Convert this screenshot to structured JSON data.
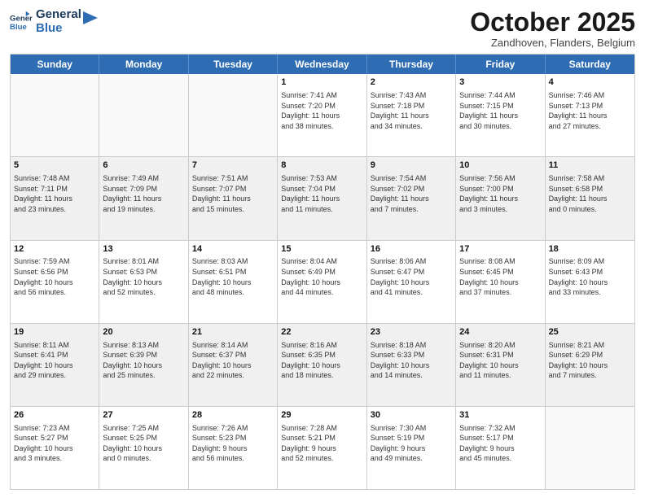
{
  "header": {
    "logo_line1": "General",
    "logo_line2": "Blue",
    "month": "October 2025",
    "location": "Zandhoven, Flanders, Belgium"
  },
  "days": [
    "Sunday",
    "Monday",
    "Tuesday",
    "Wednesday",
    "Thursday",
    "Friday",
    "Saturday"
  ],
  "rows": [
    [
      {
        "day": "",
        "info": ""
      },
      {
        "day": "",
        "info": ""
      },
      {
        "day": "",
        "info": ""
      },
      {
        "day": "1",
        "info": "Sunrise: 7:41 AM\nSunset: 7:20 PM\nDaylight: 11 hours\nand 38 minutes."
      },
      {
        "day": "2",
        "info": "Sunrise: 7:43 AM\nSunset: 7:18 PM\nDaylight: 11 hours\nand 34 minutes."
      },
      {
        "day": "3",
        "info": "Sunrise: 7:44 AM\nSunset: 7:15 PM\nDaylight: 11 hours\nand 30 minutes."
      },
      {
        "day": "4",
        "info": "Sunrise: 7:46 AM\nSunset: 7:13 PM\nDaylight: 11 hours\nand 27 minutes."
      }
    ],
    [
      {
        "day": "5",
        "info": "Sunrise: 7:48 AM\nSunset: 7:11 PM\nDaylight: 11 hours\nand 23 minutes."
      },
      {
        "day": "6",
        "info": "Sunrise: 7:49 AM\nSunset: 7:09 PM\nDaylight: 11 hours\nand 19 minutes."
      },
      {
        "day": "7",
        "info": "Sunrise: 7:51 AM\nSunset: 7:07 PM\nDaylight: 11 hours\nand 15 minutes."
      },
      {
        "day": "8",
        "info": "Sunrise: 7:53 AM\nSunset: 7:04 PM\nDaylight: 11 hours\nand 11 minutes."
      },
      {
        "day": "9",
        "info": "Sunrise: 7:54 AM\nSunset: 7:02 PM\nDaylight: 11 hours\nand 7 minutes."
      },
      {
        "day": "10",
        "info": "Sunrise: 7:56 AM\nSunset: 7:00 PM\nDaylight: 11 hours\nand 3 minutes."
      },
      {
        "day": "11",
        "info": "Sunrise: 7:58 AM\nSunset: 6:58 PM\nDaylight: 11 hours\nand 0 minutes."
      }
    ],
    [
      {
        "day": "12",
        "info": "Sunrise: 7:59 AM\nSunset: 6:56 PM\nDaylight: 10 hours\nand 56 minutes."
      },
      {
        "day": "13",
        "info": "Sunrise: 8:01 AM\nSunset: 6:53 PM\nDaylight: 10 hours\nand 52 minutes."
      },
      {
        "day": "14",
        "info": "Sunrise: 8:03 AM\nSunset: 6:51 PM\nDaylight: 10 hours\nand 48 minutes."
      },
      {
        "day": "15",
        "info": "Sunrise: 8:04 AM\nSunset: 6:49 PM\nDaylight: 10 hours\nand 44 minutes."
      },
      {
        "day": "16",
        "info": "Sunrise: 8:06 AM\nSunset: 6:47 PM\nDaylight: 10 hours\nand 41 minutes."
      },
      {
        "day": "17",
        "info": "Sunrise: 8:08 AM\nSunset: 6:45 PM\nDaylight: 10 hours\nand 37 minutes."
      },
      {
        "day": "18",
        "info": "Sunrise: 8:09 AM\nSunset: 6:43 PM\nDaylight: 10 hours\nand 33 minutes."
      }
    ],
    [
      {
        "day": "19",
        "info": "Sunrise: 8:11 AM\nSunset: 6:41 PM\nDaylight: 10 hours\nand 29 minutes."
      },
      {
        "day": "20",
        "info": "Sunrise: 8:13 AM\nSunset: 6:39 PM\nDaylight: 10 hours\nand 25 minutes."
      },
      {
        "day": "21",
        "info": "Sunrise: 8:14 AM\nSunset: 6:37 PM\nDaylight: 10 hours\nand 22 minutes."
      },
      {
        "day": "22",
        "info": "Sunrise: 8:16 AM\nSunset: 6:35 PM\nDaylight: 10 hours\nand 18 minutes."
      },
      {
        "day": "23",
        "info": "Sunrise: 8:18 AM\nSunset: 6:33 PM\nDaylight: 10 hours\nand 14 minutes."
      },
      {
        "day": "24",
        "info": "Sunrise: 8:20 AM\nSunset: 6:31 PM\nDaylight: 10 hours\nand 11 minutes."
      },
      {
        "day": "25",
        "info": "Sunrise: 8:21 AM\nSunset: 6:29 PM\nDaylight: 10 hours\nand 7 minutes."
      }
    ],
    [
      {
        "day": "26",
        "info": "Sunrise: 7:23 AM\nSunset: 5:27 PM\nDaylight: 10 hours\nand 3 minutes."
      },
      {
        "day": "27",
        "info": "Sunrise: 7:25 AM\nSunset: 5:25 PM\nDaylight: 10 hours\nand 0 minutes."
      },
      {
        "day": "28",
        "info": "Sunrise: 7:26 AM\nSunset: 5:23 PM\nDaylight: 9 hours\nand 56 minutes."
      },
      {
        "day": "29",
        "info": "Sunrise: 7:28 AM\nSunset: 5:21 PM\nDaylight: 9 hours\nand 52 minutes."
      },
      {
        "day": "30",
        "info": "Sunrise: 7:30 AM\nSunset: 5:19 PM\nDaylight: 9 hours\nand 49 minutes."
      },
      {
        "day": "31",
        "info": "Sunrise: 7:32 AM\nSunset: 5:17 PM\nDaylight: 9 hours\nand 45 minutes."
      },
      {
        "day": "",
        "info": ""
      }
    ]
  ]
}
